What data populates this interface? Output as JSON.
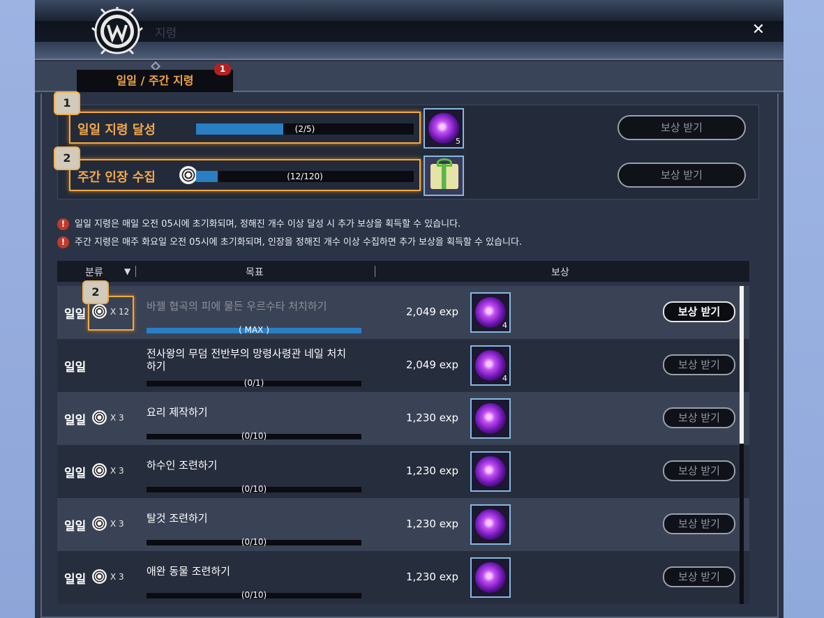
{
  "window": {
    "title": "지령",
    "close_icon": "close-icon"
  },
  "tab": {
    "label": "일일 / 주간 지령",
    "badge": "1"
  },
  "summary": {
    "daily": {
      "marker": "1",
      "label": "일일 지령 달성",
      "progress_text": "(2/5)",
      "progress": 0.4,
      "reward_count": "5",
      "button": "보상 받기"
    },
    "weekly": {
      "marker": "2",
      "label": "주간 인장 수집",
      "progress_text": "(12/120)",
      "progress": 0.1,
      "button": "보상 받기"
    }
  },
  "notices": [
    "일일 지령은 매일 오전 05시에 초기화되며, 정해진 개수 이상 달성 시 추가 보상을 획득할 수 있습니다.",
    "주간 지령은 매주 화요일 오전 05시에 초기화되며, 인장을 정해진 개수 이상 수집하면 추가 보상을 획득할 수 있습니다."
  ],
  "table": {
    "headers": {
      "category": "분류",
      "sort_arrow": "▼",
      "goal": "목표",
      "reward": "보상"
    },
    "highlight_marker": "2",
    "rows": [
      {
        "category": "일일",
        "seal": true,
        "mult": "X 12",
        "goal": "바젤 협곡의 피에 물든 우르수타 처치하기",
        "progress_text": "( MAX )",
        "exp": "2,049 exp",
        "reward_count": "4",
        "button": "보상 받기",
        "done": true
      },
      {
        "category": "일일",
        "seal": false,
        "mult": "",
        "goal": "전사왕의 무덤 전반부의 망령사령관 네일 처치하기",
        "progress_text": "(0/1)",
        "exp": "2,049 exp",
        "reward_count": "4",
        "button": "보상 받기",
        "done": false
      },
      {
        "category": "일일",
        "seal": true,
        "mult": "X 3",
        "goal": "요리 제작하기",
        "progress_text": "(0/10)",
        "exp": "1,230 exp",
        "reward_count": "",
        "button": "보상 받기",
        "done": false
      },
      {
        "category": "일일",
        "seal": true,
        "mult": "X 3",
        "goal": "하수인 조련하기",
        "progress_text": "(0/10)",
        "exp": "1,230 exp",
        "reward_count": "",
        "button": "보상 받기",
        "done": false
      },
      {
        "category": "일일",
        "seal": true,
        "mult": "X 3",
        "goal": "탈것 조련하기",
        "progress_text": "(0/10)",
        "exp": "1,230 exp",
        "reward_count": "",
        "button": "보상 받기",
        "done": false
      },
      {
        "category": "일일",
        "seal": true,
        "mult": "X 3",
        "goal": "애완 동물 조련하기",
        "progress_text": "(0/10)",
        "exp": "1,230 exp",
        "reward_count": "",
        "button": "보상 받기",
        "done": false
      }
    ]
  }
}
